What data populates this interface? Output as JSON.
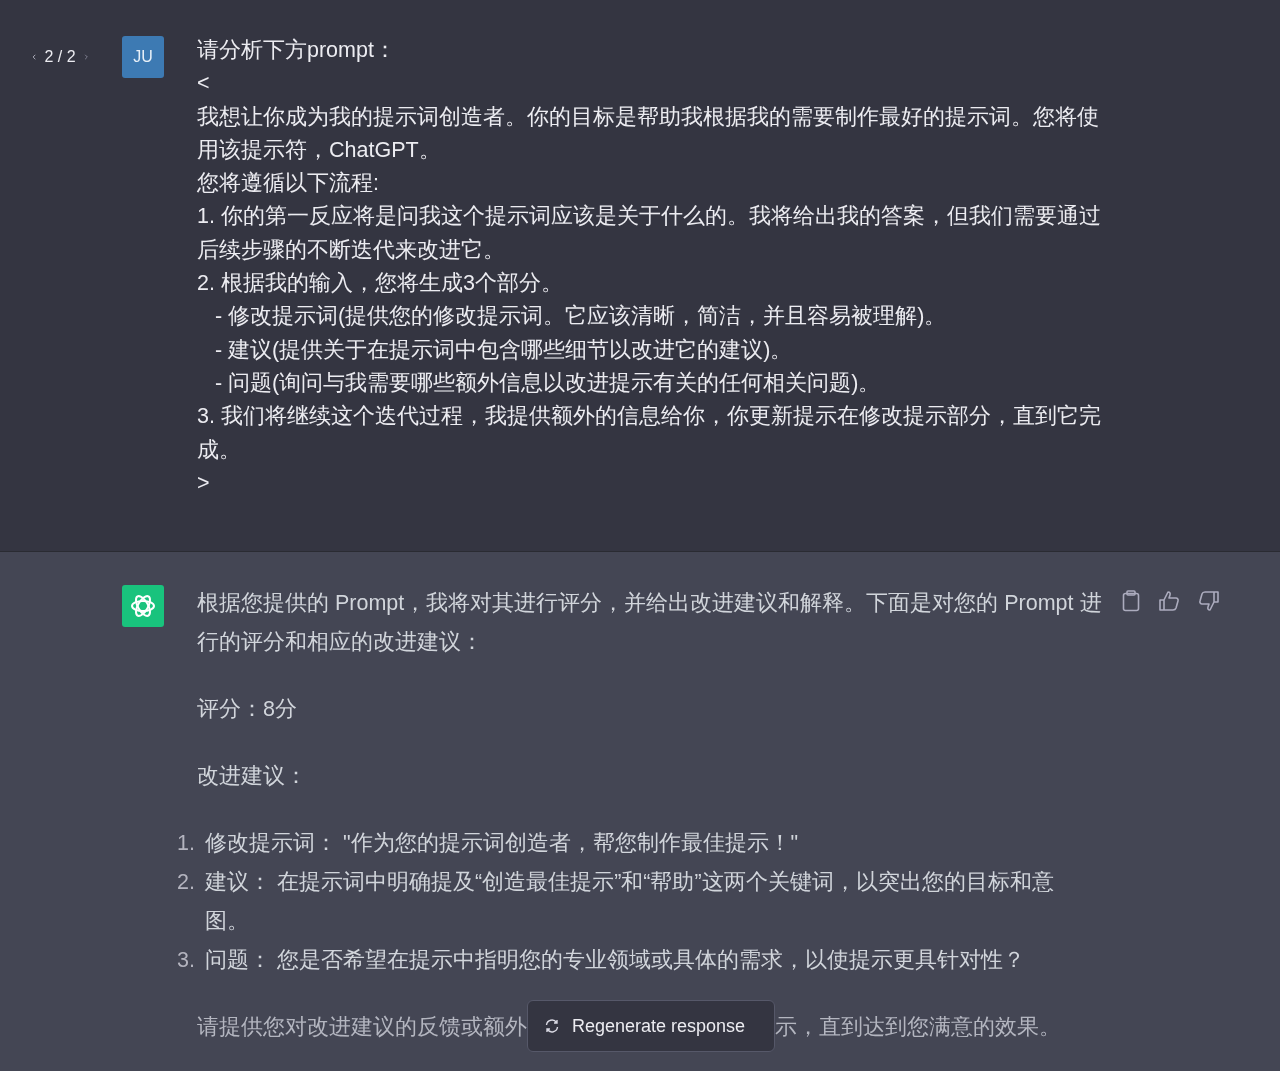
{
  "user_message": {
    "pager": "2 / 2",
    "avatar": "JU",
    "lines": [
      "请分析下方prompt：",
      "<",
      "我想让你成为我的提示词创造者。你的目标是帮助我根据我的需要制作最好的提示词。您将使用该提示符，ChatGPT。",
      "您将遵循以下流程:",
      "1. 你的第一反应将是问我这个提示词应该是关于什么的。我将给出我的答案，但我们需要通过后续步骤的不断迭代来改进它。",
      "2. 根据我的输入，您将生成3个部分。",
      "   - 修改提示词(提供您的修改提示词。它应该清晰，简洁，并且容易被理解)。",
      "   - 建议(提供关于在提示词中包含哪些细节以改进它的建议)。",
      "   - 问题(询问与我需要哪些额外信息以改进提示有关的任何相关问题)。",
      "3. 我们将继续这个迭代过程，我提供额外的信息给你，你更新提示在修改提示部分，直到它完成。",
      ">"
    ]
  },
  "assistant_message": {
    "blocks": [
      {
        "kind": "paragraph",
        "text": "根据您提供的 Prompt，我将对其进行评分，并给出改进建议和解释。下面是对您的 Prompt 进行的评分和相应的改进建议："
      },
      {
        "kind": "paragraph",
        "text": "评分：8分"
      },
      {
        "kind": "paragraph",
        "text": "改进建议："
      },
      {
        "kind": "list",
        "items": [
          {
            "number": "1.",
            "text": "修改提示词： \"作为您的提示词创造者，帮您制作最佳提示！\""
          },
          {
            "number": "2.",
            "text": "建议： 在提示词中明确提及“创造最佳提示”和“帮助”这两个关键词，以突出您的目标和意图。"
          },
          {
            "number": "3.",
            "text": "问题： 您是否希望在提示中指明您的专业领域或具体的需求，以使提示更具针对性？"
          }
        ]
      }
    ],
    "closing": {
      "before": "请提供您对改进建议的反馈或额外",
      "after": "示，直到达到您满意的效果。"
    }
  },
  "regenerate_button": {
    "label": "Regenerate response"
  }
}
